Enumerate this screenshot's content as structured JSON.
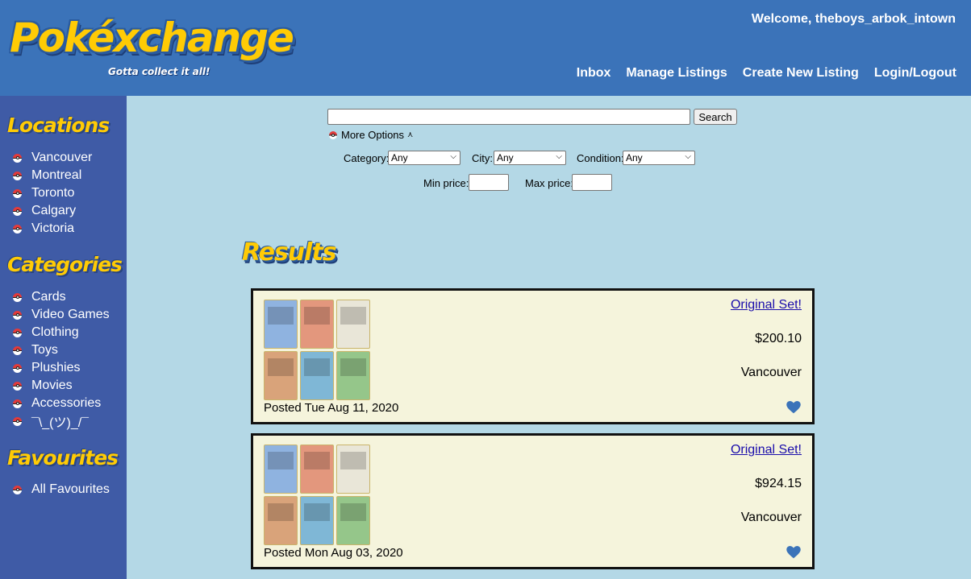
{
  "header": {
    "logo_text": "Pokéxchange",
    "tagline": "Gotta collect it all!",
    "welcome": "Welcome, theboys_arbok_intown",
    "nav": [
      "Inbox",
      "Manage Listings",
      "Create New Listing",
      "Login/Logout"
    ]
  },
  "sidebar": {
    "locations_heading": "Locations",
    "locations": [
      "Vancouver",
      "Montreal",
      "Toronto",
      "Calgary",
      "Victoria"
    ],
    "categories_heading": "Categories",
    "categories": [
      "Cards",
      "Video Games",
      "Clothing",
      "Toys",
      "Plushies",
      "Movies",
      "Accessories",
      "¯\\_(ツ)_/¯"
    ],
    "favourites_heading": "Favourites",
    "favourites": [
      "All Favourites"
    ]
  },
  "search": {
    "query": "",
    "button_label": "Search",
    "more_options_label": "More Options",
    "category_label": "Category:",
    "category_value": "Any",
    "city_label": "City:",
    "city_value": "Any",
    "condition_label": "Condition:",
    "condition_value": "Any",
    "min_price_label": "Min price:",
    "max_price_label": "Max price:"
  },
  "results_heading": "Results",
  "listings": [
    {
      "title": "Original Set!",
      "price": "$200.10",
      "city": "Vancouver",
      "posted": "Posted Tue Aug 11, 2020"
    },
    {
      "title": "Original Set!",
      "price": "$924.15",
      "city": "Vancouver",
      "posted": "Posted Mon Aug 03, 2020"
    }
  ],
  "colors": {
    "header": "#3b73b9",
    "sidebar": "#3f5ba6",
    "content": "#b4d8e6",
    "accent_yellow": "#ffcb05",
    "heart": "#3b73b9"
  }
}
